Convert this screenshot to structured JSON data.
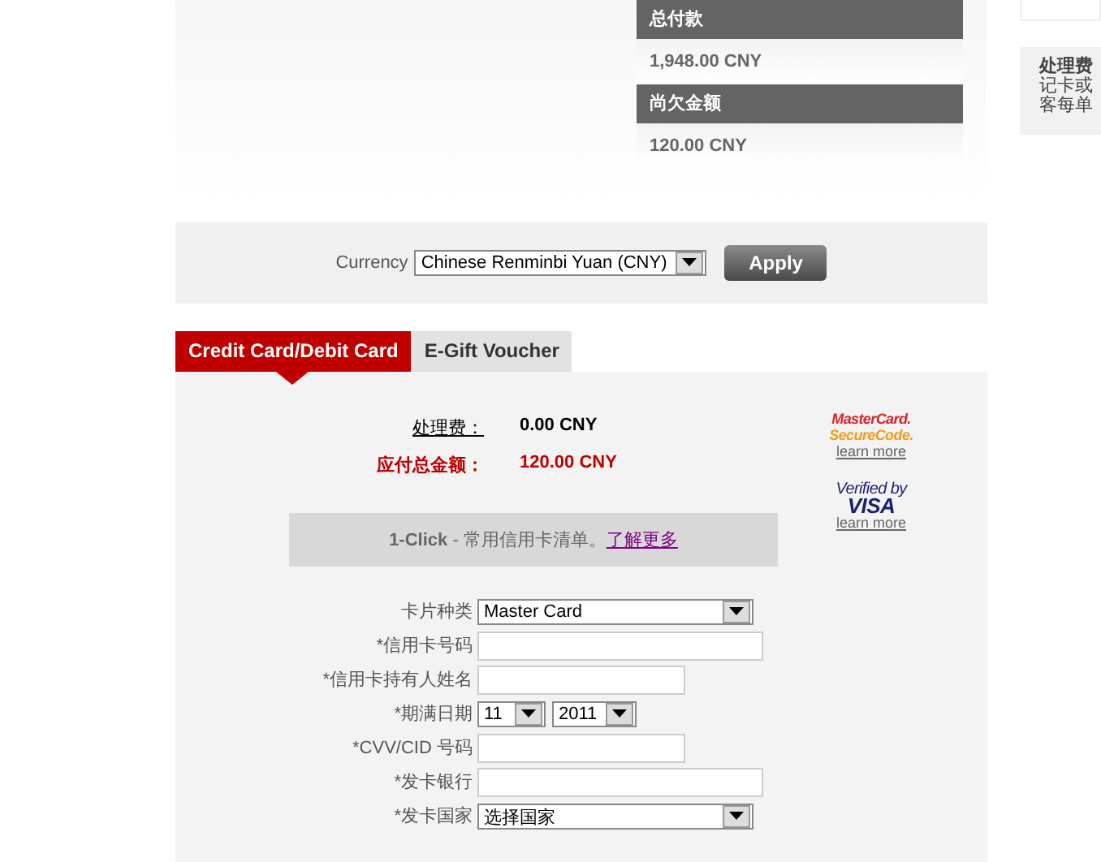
{
  "summary": [
    {
      "label": "总付款",
      "value": "1,948.00 CNY"
    },
    {
      "label": "尚欠金额",
      "value": "120.00 CNY"
    }
  ],
  "side_panel": {
    "title": "处理费",
    "lines": [
      "记卡或",
      "客每单"
    ]
  },
  "currency": {
    "label": "Currency",
    "value": "Chinese Renminbi Yuan (CNY)",
    "button": "Apply"
  },
  "tabs": [
    {
      "label": "Credit Card/Debit Card",
      "selected": true
    },
    {
      "label": "E-Gift Voucher",
      "selected": false
    }
  ],
  "fees": [
    {
      "label": "处理费：",
      "value": "0.00 CNY",
      "kind": "plain"
    },
    {
      "label": "应付总金额：",
      "value": "120.00 CNY",
      "kind": "total"
    }
  ],
  "one_click": {
    "title": "1-Click",
    "text": " - 常用信用卡清单。",
    "link": "了解更多"
  },
  "badges": [
    {
      "kind": "mastercard",
      "line1": "MasterCard.",
      "line2": "SecureCode.",
      "link": "learn more"
    },
    {
      "kind": "visa",
      "line1": "Verified by",
      "line2": "VISA",
      "link": "learn more"
    }
  ],
  "form": [
    {
      "label": "卡片种类",
      "kind": "select",
      "value": "Master Card"
    },
    {
      "label": "*信用卡号码",
      "kind": "input",
      "wide": true
    },
    {
      "label": "*信用卡持有人姓名",
      "kind": "input",
      "wide": false
    },
    {
      "label": "*期满日期",
      "kind": "date",
      "month": "11",
      "year": "2011"
    },
    {
      "label": "*CVV/CID 号码",
      "kind": "input",
      "wide": false
    },
    {
      "label": "*发卡银行",
      "kind": "input",
      "wide": true
    },
    {
      "label": "*发卡国家",
      "kind": "select",
      "value": "选择国家"
    }
  ]
}
